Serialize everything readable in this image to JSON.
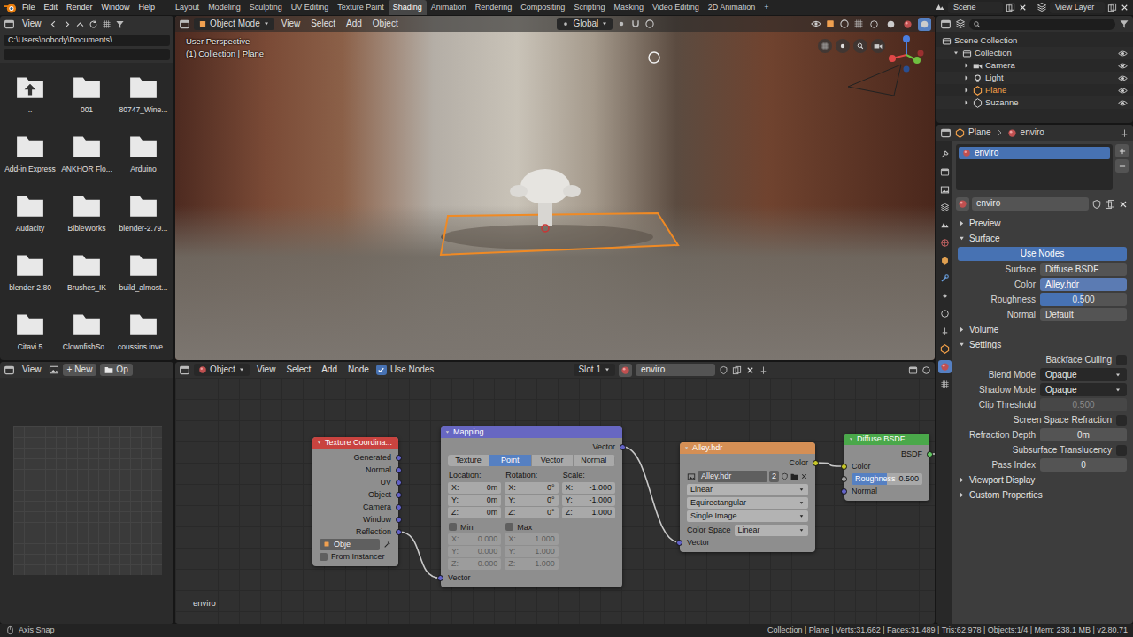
{
  "topbar": {
    "menus": [
      "File",
      "Edit",
      "Render",
      "Window",
      "Help"
    ],
    "workspaces": [
      {
        "label": "Layout",
        "selected": false
      },
      {
        "label": "Modeling",
        "selected": false
      },
      {
        "label": "Sculpting",
        "selected": false
      },
      {
        "label": "UV Editing",
        "selected": false
      },
      {
        "label": "Texture Paint",
        "selected": false
      },
      {
        "label": "Shading",
        "selected": true
      },
      {
        "label": "Animation",
        "selected": false
      },
      {
        "label": "Rendering",
        "selected": false
      },
      {
        "label": "Compositing",
        "selected": false
      },
      {
        "label": "Scripting",
        "selected": false
      },
      {
        "label": "Masking",
        "selected": false
      },
      {
        "label": "Video Editing",
        "selected": false
      },
      {
        "label": "2D Animation",
        "selected": false
      }
    ],
    "add_tab": "+",
    "scene": "Scene",
    "view_layer": "View Layer"
  },
  "file_browser": {
    "menu": "View",
    "path": "C:\\Users\\nobody\\Documents\\",
    "items": [
      {
        "label": "..",
        "kind": "parent"
      },
      {
        "label": "001",
        "kind": "folder"
      },
      {
        "label": "80747_Wine...",
        "kind": "folder"
      },
      {
        "label": "Add-in Express",
        "kind": "folder"
      },
      {
        "label": "ANKHOR Flo...",
        "kind": "folder"
      },
      {
        "label": "Arduino",
        "kind": "folder"
      },
      {
        "label": "Audacity",
        "kind": "folder"
      },
      {
        "label": "BibleWorks",
        "kind": "folder"
      },
      {
        "label": "blender-2.79...",
        "kind": "folder"
      },
      {
        "label": "blender-2.80",
        "kind": "folder"
      },
      {
        "label": "Brushes_IK",
        "kind": "folder"
      },
      {
        "label": "build_almost...",
        "kind": "folder"
      },
      {
        "label": "Citavi 5",
        "kind": "folder"
      },
      {
        "label": "ClownfishSo...",
        "kind": "folder"
      },
      {
        "label": "coussins inve...",
        "kind": "folder"
      }
    ]
  },
  "viewport": {
    "mode": "Object Mode",
    "menus": [
      "View",
      "Select",
      "Add",
      "Object"
    ],
    "orientation": "Global",
    "view_name": "User Perspective",
    "context": "(1) Collection | Plane",
    "shading_modes": [
      {
        "selected": false
      },
      {
        "selected": false
      },
      {
        "selected": false
      },
      {
        "selected": true
      }
    ]
  },
  "outliner": {
    "root": "Scene Collection",
    "items": [
      {
        "label": "Collection",
        "kind": "collection",
        "depth": 1,
        "expanded": true,
        "selected": false
      },
      {
        "label": "Camera",
        "kind": "camera",
        "depth": 2,
        "expanded": false,
        "selected": false
      },
      {
        "label": "Light",
        "kind": "light",
        "depth": 2,
        "expanded": false,
        "selected": false
      },
      {
        "label": "Plane",
        "kind": "mesh",
        "depth": 2,
        "expanded": false,
        "selected": true
      },
      {
        "label": "Suzanne",
        "kind": "mesh",
        "depth": 2,
        "expanded": false,
        "selected": false
      }
    ]
  },
  "properties": {
    "breadcrumb": [
      "Plane",
      "enviro"
    ],
    "tabs": [
      {
        "selected": false
      },
      {
        "selected": false
      },
      {
        "selected": false
      },
      {
        "selected": false
      },
      {
        "selected": false
      },
      {
        "selected": false
      },
      {
        "selected": false
      },
      {
        "selected": false
      },
      {
        "selected": false
      },
      {
        "selected": false
      },
      {
        "selected": false
      },
      {
        "selected": false
      },
      {
        "selected": true
      },
      {
        "selected": false
      }
    ],
    "slots": [
      {
        "label": "enviro",
        "selected": true
      }
    ],
    "material": "enviro",
    "sections": [
      {
        "title": "Preview",
        "expanded": false,
        "rows": []
      },
      {
        "title": "Surface",
        "expanded": true,
        "rows": [
          {
            "kind": "button",
            "label": "Use Nodes",
            "on": true,
            "disabled": false
          },
          {
            "kind": "field",
            "label": "Surface",
            "value": "Diffuse BSDF",
            "disabled": false
          },
          {
            "kind": "link",
            "label": "Color",
            "value": "Alley.hdr",
            "disabled": false
          },
          {
            "kind": "slider",
            "label": "Roughness",
            "value": "0.500",
            "level": 0.5,
            "disabled": false
          },
          {
            "kind": "field",
            "label": "Normal",
            "value": "Default",
            "disabled": false
          }
        ]
      },
      {
        "title": "Volume",
        "expanded": false,
        "rows": []
      },
      {
        "title": "Settings",
        "expanded": true,
        "rows": [
          {
            "kind": "check",
            "label": "Backface Culling",
            "checked": false,
            "disabled": false
          },
          {
            "kind": "dropdown",
            "label": "Blend Mode",
            "value": "Opaque",
            "disabled": false
          },
          {
            "kind": "dropdown",
            "label": "Shadow Mode",
            "value": "Opaque",
            "disabled": false
          },
          {
            "kind": "number",
            "label": "Clip Threshold",
            "value": "0.500",
            "disabled": true
          },
          {
            "kind": "check",
            "label": "Screen Space Refraction",
            "checked": false,
            "disabled": false
          },
          {
            "kind": "number",
            "label": "Refraction Depth",
            "value": "0m",
            "disabled": false
          },
          {
            "kind": "check",
            "label": "Subsurface Translucency",
            "checked": false,
            "disabled": false
          },
          {
            "kind": "number",
            "label": "Pass Index",
            "value": "0",
            "disabled": false
          }
        ]
      },
      {
        "title": "Viewport Display",
        "expanded": false,
        "rows": []
      },
      {
        "title": "Custom Properties",
        "expanded": false,
        "rows": []
      }
    ]
  },
  "image_editor": {
    "menu": "View",
    "new_icon": "+",
    "new": "New",
    "open": "Op"
  },
  "node_editor": {
    "editor": "Object",
    "menus": [
      "View",
      "Select",
      "Add",
      "Node"
    ],
    "use_nodes": {
      "label": "Use Nodes",
      "checked": true
    },
    "slot": "Slot 1",
    "material": "enviro",
    "canvas_label": "enviro",
    "nodes": [
      {
        "kind": "texcoord",
        "title": "Texture Coordina...",
        "color": "#c9433f",
        "outputs": [
          {
            "label": "Generated",
            "type": "vector"
          },
          {
            "label": "Normal",
            "type": "vector"
          },
          {
            "label": "UV",
            "type": "vector"
          },
          {
            "label": "Object",
            "type": "vector"
          },
          {
            "label": "Camera",
            "type": "vector"
          },
          {
            "label": "Window",
            "type": "vector"
          },
          {
            "label": "Reflection",
            "type": "vector"
          }
        ],
        "object_field": "Obje",
        "checks": [
          {
            "label": "From Instancer",
            "checked": false
          }
        ],
        "inputs": []
      },
      {
        "kind": "mapping",
        "title": "Mapping",
        "color": "#6767c2",
        "outputs": [
          {
            "label": "Vector",
            "type": "vector"
          }
        ],
        "tabs": [
          {
            "label": "Texture",
            "selected": false
          },
          {
            "label": "Point",
            "selected": true
          },
          {
            "label": "Vector",
            "selected": false
          },
          {
            "label": "Normal",
            "selected": false
          }
        ],
        "columns": [
          {
            "title": "Location:",
            "values": [
              [
                "X:",
                "0m"
              ],
              [
                "Y:",
                "0m"
              ],
              [
                "Z:",
                "0m"
              ]
            ]
          },
          {
            "title": "Rotation:",
            "values": [
              [
                "X:",
                "0°"
              ],
              [
                "Y:",
                "0°"
              ],
              [
                "Z:",
                "0°"
              ]
            ]
          },
          {
            "title": "Scale:",
            "values": [
              [
                "X:",
                "-1.000"
              ],
              [
                "Y:",
                "-1.000"
              ],
              [
                "Z:",
                "1.000"
              ]
            ]
          }
        ],
        "limits": [
          {
            "label": "Min",
            "checked": false,
            "values": [
              [
                "X:",
                "0.000"
              ],
              [
                "Y:",
                "0.000"
              ],
              [
                "Z:",
                "0.000"
              ]
            ]
          },
          {
            "label": "Max",
            "checked": false,
            "values": [
              [
                "X:",
                "1.000"
              ],
              [
                "Y:",
                "1.000"
              ],
              [
                "Z:",
                "1.000"
              ]
            ]
          }
        ],
        "inputs": [
          {
            "label": "Vector",
            "type": "vector",
            "kind": "socket"
          }
        ]
      },
      {
        "kind": "image",
        "title": "Alley.hdr",
        "color": "#d58f55",
        "outputs": [
          {
            "label": "Color",
            "type": "color"
          }
        ],
        "image": "Alley.hdr",
        "users": "2",
        "dropdowns": [
          "Linear",
          "Equirectangular",
          "Single Image"
        ],
        "color_space": {
          "label": "Color Space",
          "value": "Linear"
        },
        "inputs": [
          {
            "label": "Vector",
            "type": "vector",
            "kind": "socket"
          }
        ]
      },
      {
        "kind": "bsdf",
        "title": "Diffuse BSDF",
        "color": "#4aa84a",
        "outputs": [
          {
            "label": "BSDF",
            "type": "shader"
          }
        ],
        "inputs": [
          {
            "label": "Color",
            "type": "color",
            "kind": "socket"
          },
          {
            "label": "Roughness",
            "type": "float",
            "kind": "slider",
            "value": "0.500",
            "level": 0.5
          },
          {
            "label": "Normal",
            "type": "vector",
            "kind": "socket"
          }
        ]
      }
    ],
    "links": [
      {
        "from": [
          0,
          "Reflection"
        ],
        "to": [
          1,
          "Vector"
        ]
      },
      {
        "from": [
          1,
          "Vector"
        ],
        "to": [
          2,
          "Vector"
        ]
      },
      {
        "from": [
          2,
          "Color"
        ],
        "to": [
          3,
          "Color"
        ]
      },
      {
        "from": [
          3,
          "BSDF"
        ],
        "to": null
      }
    ]
  },
  "status_bar": {
    "left": "Axis Snap",
    "right": "Collection | Plane | Verts:31,662 | Faces:31,489 | Tris:62,978 | Objects:1/4 | Mem: 238.1 MB | v2.80.71"
  }
}
